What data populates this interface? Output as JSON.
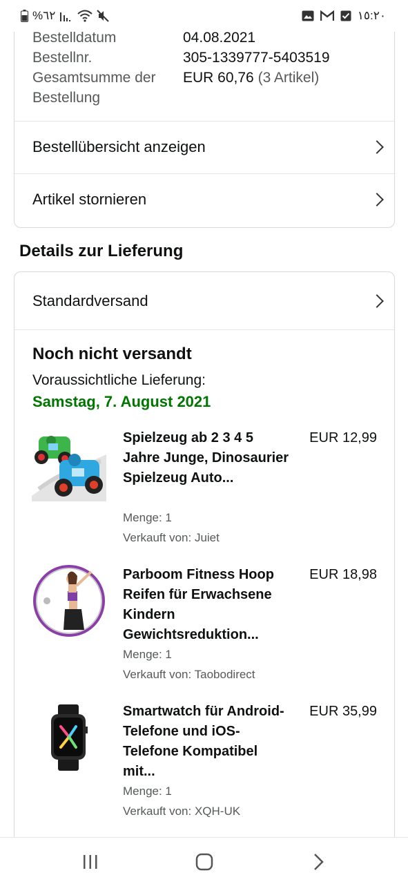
{
  "status_bar": {
    "battery": "%٦٢",
    "time": "١٥:٢٠"
  },
  "order": {
    "date_label": "Bestelldatum",
    "date_value": "04.08.2021",
    "number_label": "Bestellnr.",
    "number_value": "305-1339777-5403519",
    "total_label_1": "Gesamtsumme der",
    "total_label_2": "Bestellung",
    "total_value": "EUR 60,76",
    "total_count": "(3 Artikel)"
  },
  "actions": {
    "view_summary": "Bestellübersicht anzeigen",
    "cancel_items": "Artikel stornieren"
  },
  "delivery": {
    "section_title": "Details zur Lieferung",
    "shipping_method": "Standardversand",
    "status": "Noch nicht versandt",
    "eta_label": "Voraussichtliche Lieferung:",
    "eta_date": "Samstag, 7. August 2021",
    "eta_color": "#007600"
  },
  "items": [
    {
      "title": "Spielzeug ab 2 3 4 5 Jahre Junge, Dinosaurier Spielzeug Auto...",
      "price": "EUR 12,99",
      "quantity": "Menge: 1",
      "seller": "Verkauft von: Juiet",
      "image": "toy-car-image"
    },
    {
      "title": "Parboom Fitness Hoop Reifen für Erwachsene Kindern Gewichtsreduktion...",
      "price": "EUR 18,98",
      "quantity": "Menge: 1",
      "seller": "Verkauft von: Taobodirect",
      "image": "fitness-hoop-image"
    },
    {
      "title": "Smartwatch für Android-Telefone und iOS-Telefone Kompatibel mit...",
      "price": "EUR 35,99",
      "quantity": "Menge: 1",
      "seller": "Verkauft von: XQH-UK",
      "image": "smartwatch-image"
    }
  ],
  "icons": {
    "status_left": [
      "battery-icon",
      "signal-icon",
      "wifi-icon",
      "mute-icon"
    ],
    "status_right": [
      "gallery-icon",
      "gmail-icon",
      "checkbox-icon"
    ],
    "nav": [
      "recents-icon",
      "home-icon",
      "back-icon"
    ]
  }
}
